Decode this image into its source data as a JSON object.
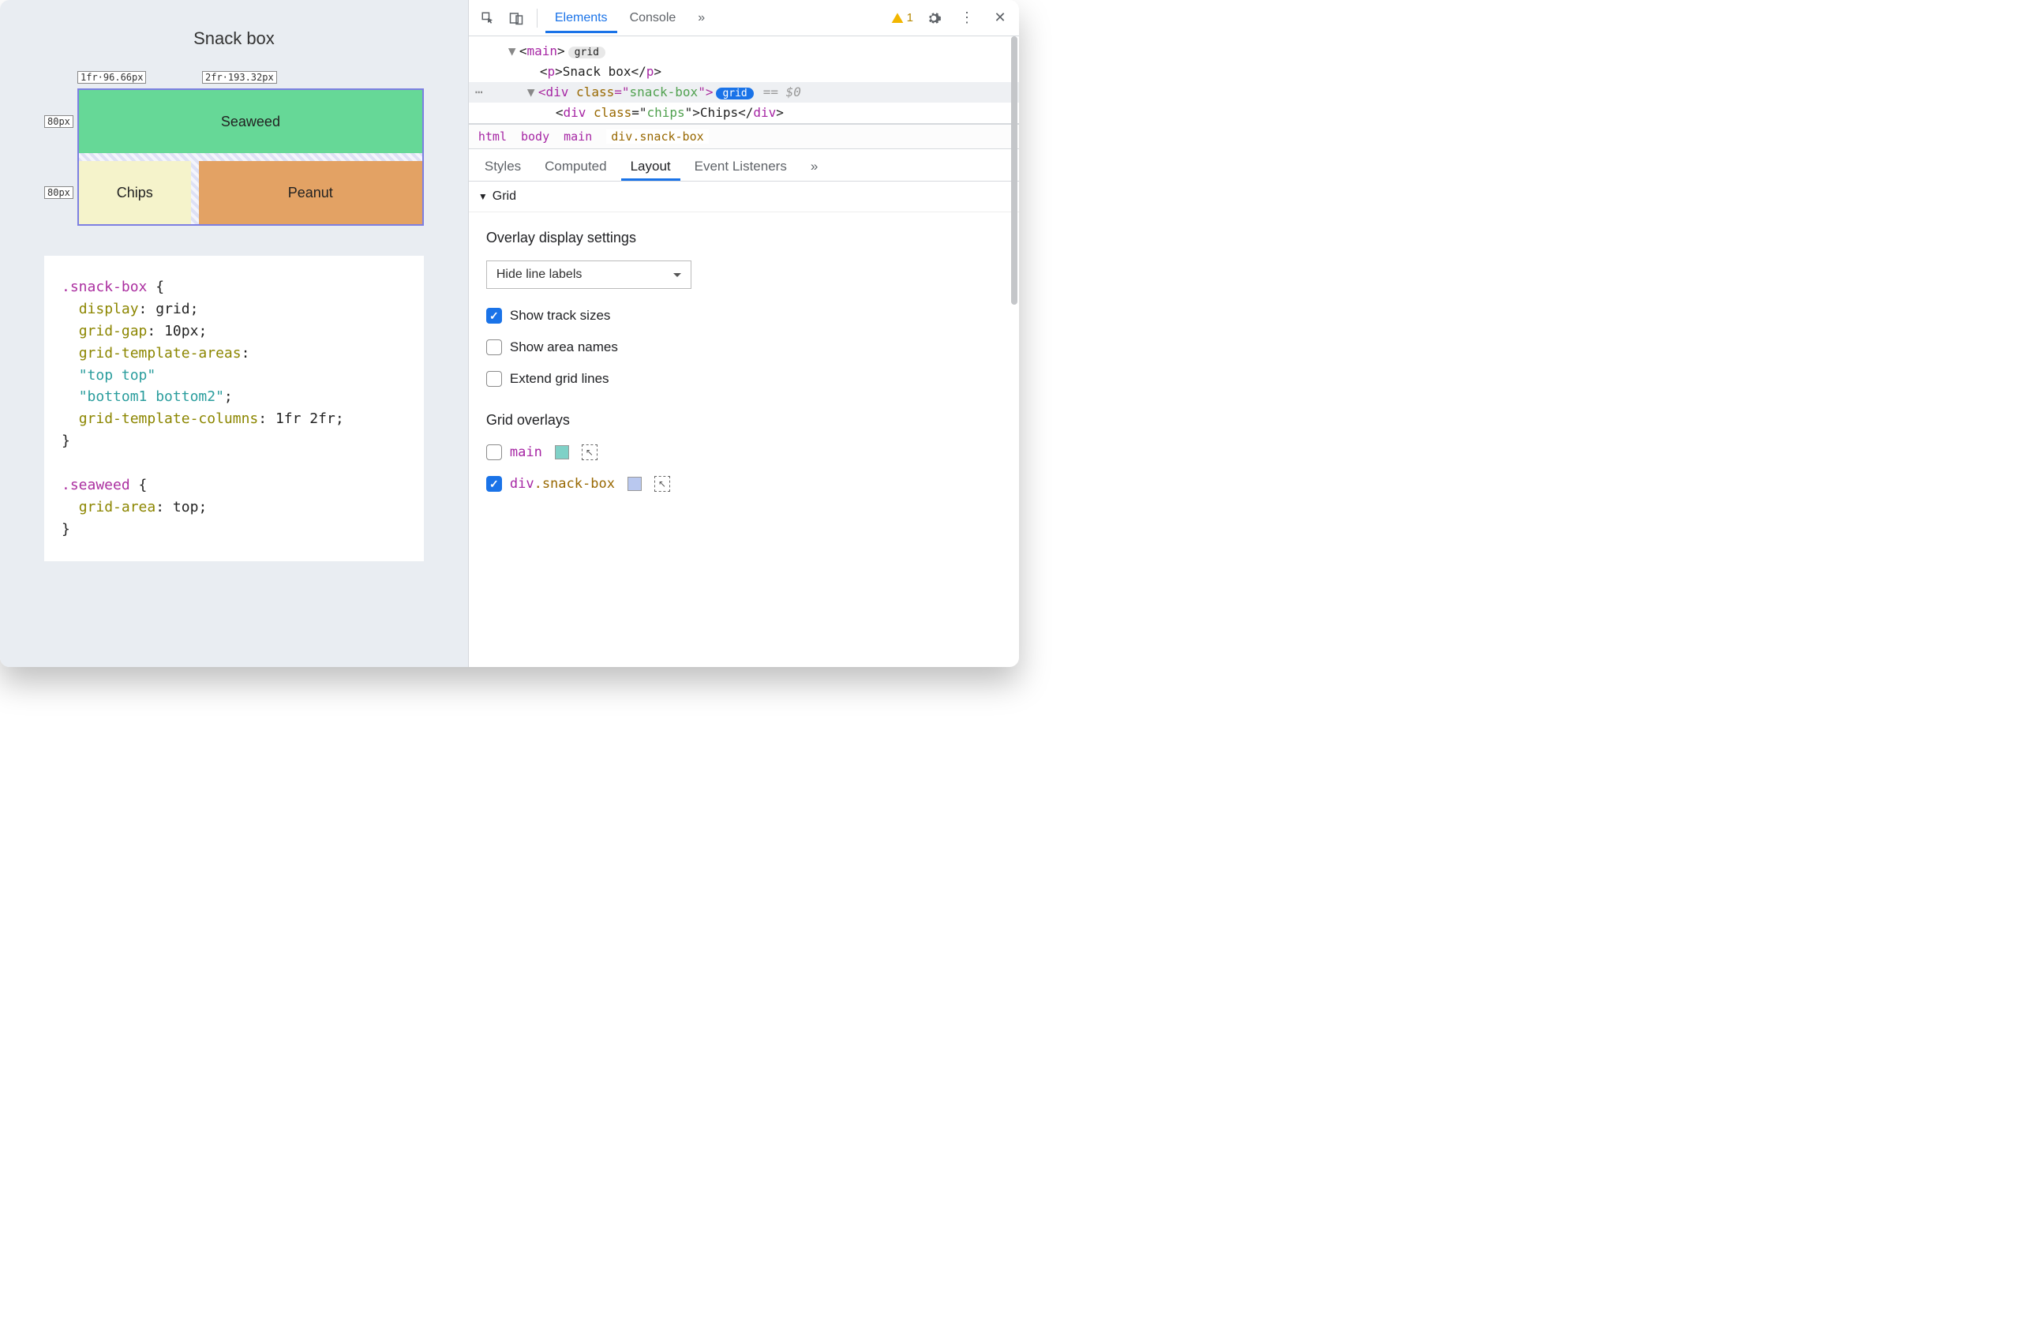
{
  "preview": {
    "title": "Snack box",
    "col_labels": [
      "1fr·96.66px",
      "2fr·193.32px"
    ],
    "row_labels": [
      "80px",
      "80px"
    ],
    "cells": {
      "seaweed": "Seaweed",
      "chips": "Chips",
      "peanut": "Peanut"
    },
    "css": {
      "sel1": ".snack-box",
      "p_display": "display",
      "v_display": "grid",
      "p_gap": "grid-gap",
      "v_gap": "10px",
      "p_areas": "grid-template-areas",
      "v_areas1": "\"top top\"",
      "v_areas2": "\"bottom1 bottom2\"",
      "p_cols": "grid-template-columns",
      "v_cols": "1fr 2fr",
      "sel2": ".seaweed",
      "p_area": "grid-area",
      "v_area": "top"
    }
  },
  "toolbar": {
    "tabs": [
      "Elements",
      "Console"
    ],
    "more": "»",
    "warn_count": "1"
  },
  "dom": {
    "main_tag": "main",
    "main_badge": "grid",
    "p_tag": "p",
    "p_text": "Snack box",
    "div_tag": "div",
    "div_class_attr": "class",
    "div_class_val": "snack-box",
    "div_badge": "grid",
    "div_eq": "== $0",
    "child_tag": "div",
    "child_class_val": "chips",
    "child_text": "Chips"
  },
  "breadcrumb": [
    "html",
    "body",
    "main",
    "div.snack-box"
  ],
  "subtabs": [
    "Styles",
    "Computed",
    "Layout",
    "Event Listeners"
  ],
  "layout": {
    "section": "Grid",
    "overlay_title": "Overlay display settings",
    "select_value": "Hide line labels",
    "opts": {
      "track_sizes": "Show track sizes",
      "area_names": "Show area names",
      "extend": "Extend grid lines"
    },
    "overlays_title": "Grid overlays",
    "overlays": {
      "main": {
        "label": "main",
        "color": "#7fd1c7",
        "checked": false
      },
      "snack": {
        "prefix": "div",
        "cls": ".snack-box",
        "color": "#b9c8ef",
        "checked": true
      }
    }
  }
}
